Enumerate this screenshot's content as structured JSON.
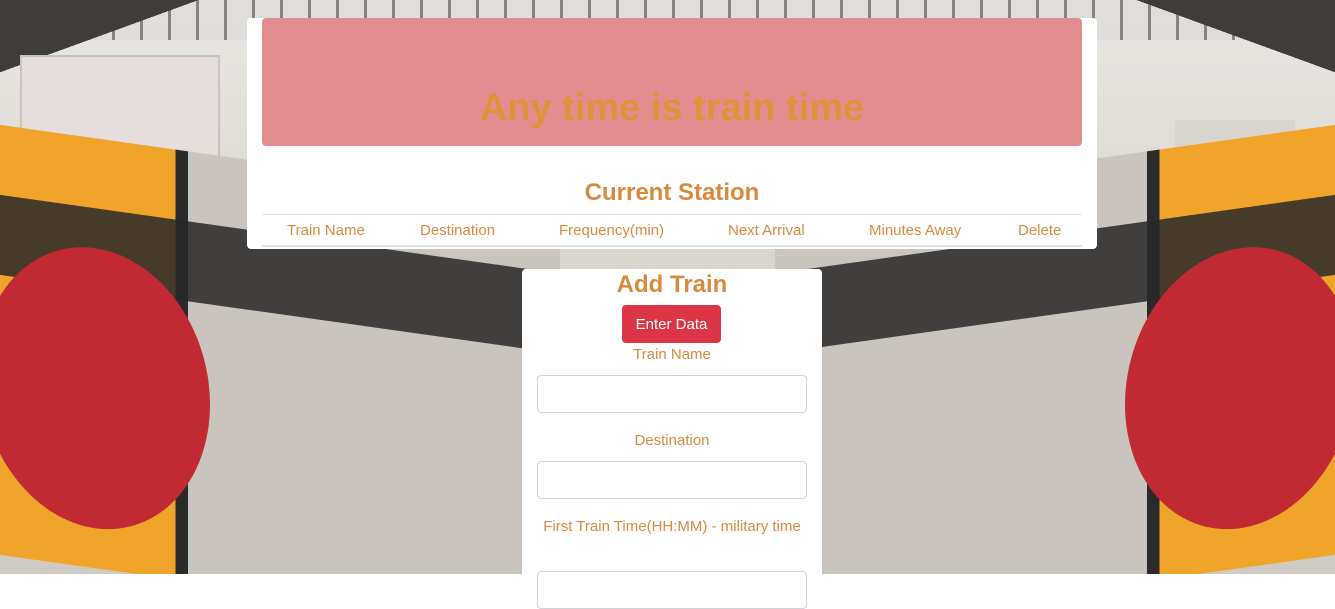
{
  "header": {
    "title": "Any time is train time"
  },
  "station": {
    "title": "Current Station",
    "columns": [
      "Train Name",
      "Destination",
      "Frequency(min)",
      "Next Arrival",
      "Minutes Away",
      "Delete"
    ]
  },
  "add_train": {
    "title": "Add Train",
    "submit_label": "Enter Data",
    "fields": [
      {
        "label": "Train Name",
        "value": ""
      },
      {
        "label": "Destination",
        "value": ""
      },
      {
        "label": "First Train Time(HH:MM) - military time",
        "value": ""
      }
    ]
  },
  "colors": {
    "jumbotron_bg": "#e48d91",
    "accent_text": "#d98a3c",
    "button_bg": "#dc3545"
  }
}
